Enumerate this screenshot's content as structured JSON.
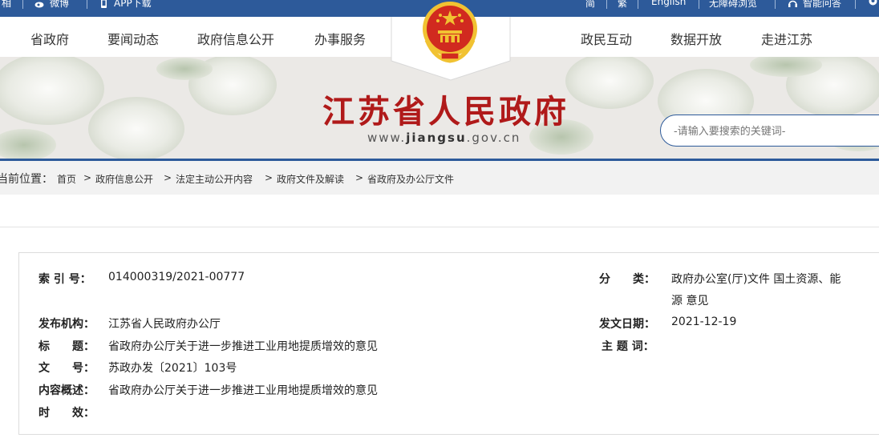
{
  "topbar": {
    "left_text": "相",
    "weibo_label": "微博",
    "app_label": "APP下载",
    "simplified": "简",
    "traditional": "繁",
    "english": "English",
    "accessible": "无障碍浏览",
    "smart_qa": "智能问答"
  },
  "nav": {
    "left": [
      "省政府",
      "要闻动态",
      "政府信息公开",
      "办事服务"
    ],
    "right": [
      "政民互动",
      "数据开放",
      "走进江苏"
    ]
  },
  "banner": {
    "title": "江苏省人民政府",
    "url_prefix": "www.",
    "url_bold": "jiangsu",
    "url_suffix": ".gov.cn",
    "search_placeholder": "-请输入要搜索的关键词-"
  },
  "breadcrumb": {
    "label": "当前位置：",
    "items": [
      "首页",
      "政府信息公开",
      "法定主动公开内容",
      "政府文件及解读",
      "省政府及办公厅文件"
    ]
  },
  "info": {
    "index_key": "索 引 号：",
    "index_val": "014000319/2021-00777",
    "category_key": "分　　类：",
    "category_val_1": "政府办公室(厅)文件 国土资源、能",
    "category_val_2": "源 意见",
    "publisher_key": "发布机构：",
    "publisher_val": "江苏省人民政府办公厅",
    "date_key": "发文日期：",
    "date_val": "2021-12-19",
    "title_key": "标　　题：",
    "title_val": "省政府办公厅关于进一步推进工业用地提质增效的意见",
    "subject_key": "主 题 词：",
    "subject_val": "",
    "docno_key": "文　　号：",
    "docno_val": "苏政办发〔2021〕103号",
    "summary_key": "内容概述：",
    "summary_val": "省政府办公厅关于进一步推进工业用地提质增效的意见",
    "validity_key": "时　　效：",
    "validity_val": ""
  },
  "colors": {
    "primary_blue": "#2d5a9a",
    "title_red": "#b01a1a",
    "emblem_red": "#d12a1f",
    "emblem_gold": "#f1c232"
  }
}
